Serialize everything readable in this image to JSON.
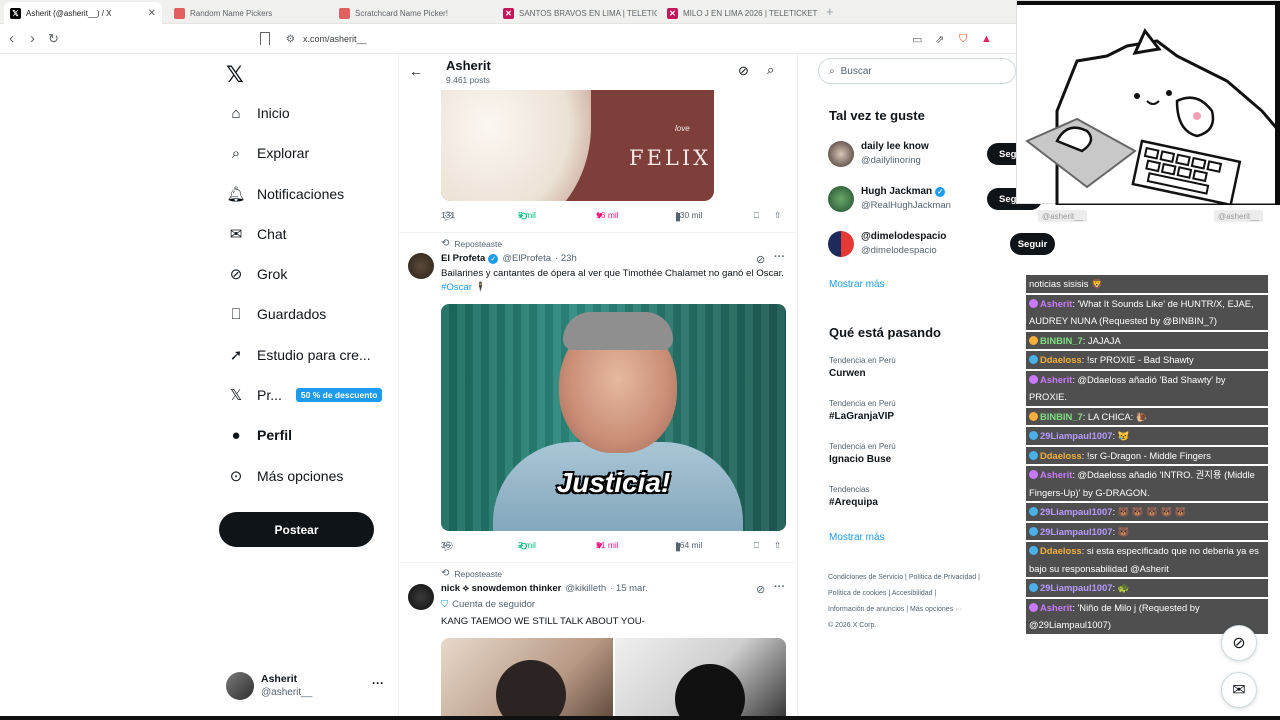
{
  "browser": {
    "tabs": [
      {
        "title": "Asherit (@asherit__) / X",
        "icon": "x-icon",
        "active": true
      },
      {
        "title": "Random Name Pickers",
        "icon": "picker-icon"
      },
      {
        "title": "Scratchcard Name Picker!",
        "icon": "picker-icon"
      },
      {
        "title": "SANTOS BRAVOS EN LIMA | TELETICK",
        "icon": "teleticket-icon"
      },
      {
        "title": "MILO J EN LIMA 2026 | TELETICKET",
        "icon": "teleticket-icon"
      }
    ],
    "url": "x.com/asherit__"
  },
  "nav": {
    "items": [
      {
        "label": "Inicio",
        "icon": "home-icon"
      },
      {
        "label": "Explorar",
        "icon": "search-icon"
      },
      {
        "label": "Notificaciones",
        "icon": "bell-icon"
      },
      {
        "label": "Chat",
        "icon": "mail-icon"
      },
      {
        "label": "Grok",
        "icon": "grok-icon"
      },
      {
        "label": "Guardados",
        "icon": "bookmark-icon"
      },
      {
        "label": "Estudio para cre...",
        "icon": "rocket-icon"
      },
      {
        "label": "Pr...",
        "icon": "x-icon"
      },
      {
        "label": "Perfil",
        "icon": "person-icon"
      },
      {
        "label": "Más opciones",
        "icon": "more-circle-icon"
      }
    ],
    "premium_badge": "50 % de descuento",
    "post_button": "Postear",
    "account": {
      "name": "Asherit",
      "handle": "@asherit__"
    }
  },
  "profile_header": {
    "name": "Asherit",
    "posts": "9.461 posts"
  },
  "feed": {
    "post1_stats": {
      "replies": "131",
      "reposts": "5 mil",
      "likes": "16 mil",
      "views": "130 mil"
    },
    "post1_image_text": "FELIX",
    "post1_image_small": "love",
    "post2": {
      "repost_label": "Reposteaste",
      "author": "El Profeta",
      "handle": "@ElProfeta",
      "time": "· 23h",
      "text": "Bailarines y cantantes de ópera al ver que Timothée Chalamet no ganó el Oscar.",
      "hashtag": "#Oscar",
      "emoji": "🕴",
      "image_caption": "Justicia!",
      "stats": {
        "replies": "36",
        "reposts": "2 mil",
        "likes": "21 mil",
        "views": "164 mil"
      }
    },
    "post3": {
      "repost_label": "Reposteaste",
      "author": "nick ⟡ snowdemon thinker",
      "handle": "@kikilleth",
      "time": "· 15 mar.",
      "follower_note": "Cuenta de seguidor",
      "text": "KANG TAEMOO WE STILL TALK ABOUT YOU-"
    }
  },
  "right": {
    "search_placeholder": "Buscar",
    "who_title": "Tal vez te guste",
    "who": [
      {
        "name": "daily lee know",
        "handle": "@dailylinoring",
        "button": "Seg",
        "verified": false
      },
      {
        "name": "Hugh Jackman",
        "handle": "@RealHughJackman",
        "button": "Seg",
        "verified": true
      },
      {
        "name": "@dimelodespacio",
        "handle": "@dimelodespacio",
        "button": "Seguir",
        "verified": false
      }
    ],
    "show_more": "Mostrar más",
    "trends_title": "Qué está pasando",
    "trends": [
      {
        "context": "Tendencia en Perú",
        "topic": "Curwen"
      },
      {
        "context": "Tendencia en Perú",
        "topic": "#LaGranjaVIP"
      },
      {
        "context": "Tendencia en Perú",
        "topic": "Ignacio Buse"
      },
      {
        "context": "Tendencias",
        "topic": "#Arequipa"
      }
    ],
    "trends_more": "Mostrar más",
    "footer": {
      "l1a": "Condiciones de Servicio",
      "l1b": "Política de Privacidad",
      "l2a": "Política de cookies",
      "l2b": "Accesibilidad",
      "l3a": "Información de anuncios",
      "l3b": "Más opciones ···",
      "copyright": "© 2026 X Corp."
    }
  },
  "overlay": {
    "chat_user_left": "@asherit__",
    "chat_user_right": "@asherit__",
    "messages": [
      {
        "user": "",
        "text": "noticias sisisis 🦁"
      },
      {
        "user": "Asherit",
        "text": ": 'What It Sounds Like' de HUNTR/X, EJAE, AUDREY NUNA (Requested by @BINBIN_7)"
      },
      {
        "user": "BINBIN_7",
        "text": ": JAJAJA"
      },
      {
        "user": "Ddaeloss",
        "text": ": !sr PROXIE - Bad Shawty"
      },
      {
        "user": "Asherit",
        "text": ": @Ddaeloss añadió 'Bad Shawty' by PROXIE."
      },
      {
        "user": "BINBIN_7",
        "text": ": LA CHICA: 🐌"
      },
      {
        "user": "29Liampaul1007",
        "text": ": 😿"
      },
      {
        "user": "Ddaeloss",
        "text": ": !sr G-Dragon - Middle Fingers"
      },
      {
        "user": "Asherit",
        "text": ": @Ddaeloss añadió 'INTRO. 권지용 (Middle Fingers-Up)' by G-DRAGON."
      },
      {
        "user": "29Liampaul1007",
        "text": ": 🐻 🐻 🐻 🐻 🐻"
      },
      {
        "user": "29Liampaul1007",
        "text": ": 🐻"
      },
      {
        "user": "Ddaeloss",
        "text": ": si esta especificado que no deberia ya es bajo su responsabilidad @Asherit"
      },
      {
        "user": "29Liampaul1007",
        "text": ": 🐢"
      },
      {
        "user": "Asherit",
        "text": ": 'Niño de Milo j (Requested by @29Liampaul1007)"
      }
    ]
  }
}
